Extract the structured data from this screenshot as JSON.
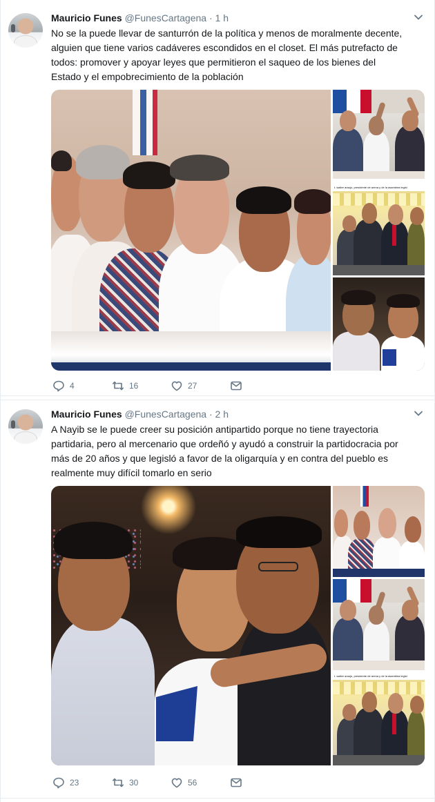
{
  "tweets": [
    {
      "author_name": "Mauricio Funes",
      "handle": "@FunesCartagena",
      "separator": "·",
      "time": "1 h",
      "text_lines": [
        "No se la puede llevar de santurrón de la política y menos de moralmente decente,",
        "alguien que tiene varios cadáveres escondidos en el closet. El más putrefacto de",
        "todos: promover y apoyar leyes que permitieron el saqueo de los bienes del",
        "Estado y el empobrecimiento de la población"
      ],
      "caption_in_photo": "t. walter araujo, presidente de arena y de la asamblea legisl",
      "replies": "4",
      "retweets": "16",
      "likes": "27",
      "icons": [
        "reply-icon",
        "retweet-icon",
        "like-icon",
        "message-icon",
        "chevron-down-icon"
      ]
    },
    {
      "author_name": "Mauricio Funes",
      "handle": "@FunesCartagena",
      "separator": "·",
      "time": "2 h",
      "text_lines": [
        "A Nayib se le puede creer su posición antipartido porque no tiene trayectoria",
        "partidaria, pero al mercenario que ordeñó y ayudó a construir la partidocracia por",
        "más de 20 años y que legisló a favor de la oligarquía y en contra del pueblo es",
        "realmente muy difícil tomarlo en serio"
      ],
      "caption_in_photo": "t. walter araujo, presidente de arena y de la asamblea legisl",
      "replies": "23",
      "retweets": "30",
      "likes": "56",
      "icons": [
        "reply-icon",
        "retweet-icon",
        "like-icon",
        "message-icon",
        "chevron-down-icon"
      ]
    }
  ],
  "colors": {
    "text": "#14171a",
    "secondary": "#657786",
    "border": "#e6ecf0"
  }
}
